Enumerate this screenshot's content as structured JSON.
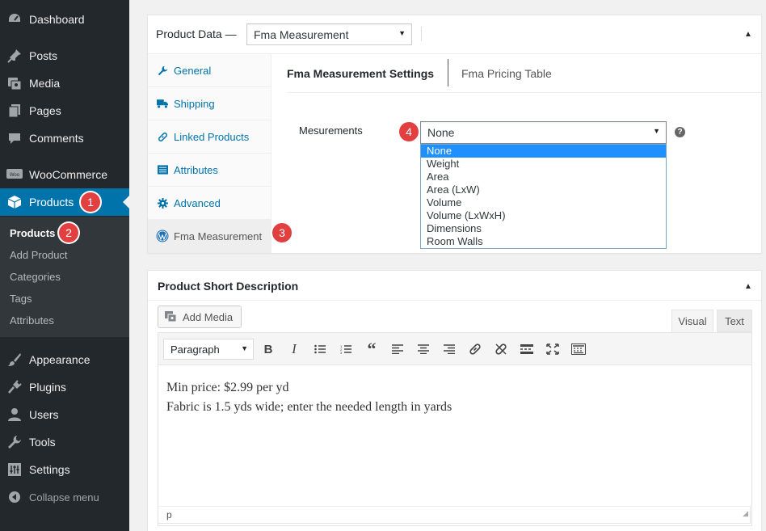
{
  "sidebar": {
    "menu": [
      {
        "label": "Dashboard",
        "icon": "dashboard-icon"
      },
      {
        "label": "Posts",
        "icon": "pushpin-icon"
      },
      {
        "label": "Media",
        "icon": "media-icon"
      },
      {
        "label": "Pages",
        "icon": "pages-icon"
      },
      {
        "label": "Comments",
        "icon": "comments-icon"
      },
      {
        "label": "WooCommerce",
        "icon": "woocommerce-icon"
      },
      {
        "label": "Products",
        "icon": "box-icon",
        "badge": "1"
      },
      {
        "label": "Appearance",
        "icon": "paintbrush-icon"
      },
      {
        "label": "Plugins",
        "icon": "plug-icon"
      },
      {
        "label": "Users",
        "icon": "user-icon"
      },
      {
        "label": "Tools",
        "icon": "wrench-icon"
      },
      {
        "label": "Settings",
        "icon": "settings-icon"
      },
      {
        "label": "Collapse menu",
        "icon": "collapse-icon"
      }
    ],
    "submenu": [
      {
        "label": "Products",
        "badge": "2"
      },
      {
        "label": "Add Product"
      },
      {
        "label": "Categories"
      },
      {
        "label": "Tags"
      },
      {
        "label": "Attributes"
      }
    ]
  },
  "product_data": {
    "title": "Product Data —",
    "type_select": "Fma Measurement",
    "tabs": [
      {
        "label": "General",
        "icon": "wrench-icon"
      },
      {
        "label": "Shipping",
        "icon": "truck-icon"
      },
      {
        "label": "Linked Products",
        "icon": "link-icon"
      },
      {
        "label": "Attributes",
        "icon": "list-icon"
      },
      {
        "label": "Advanced",
        "icon": "gear-icon"
      },
      {
        "label": "Fma Measurement",
        "icon": "wordpress-icon",
        "badge": "3"
      }
    ],
    "subtabs": [
      "Fma Measurement Settings",
      "Fma Pricing Table"
    ],
    "field_label": "Mesurements",
    "field_value": "None",
    "field_badge": "4",
    "options": [
      "None",
      "Weight",
      "Area",
      "Area (LxW)",
      "Volume",
      "Volume (LxWxH)",
      "Dimensions",
      "Room Walls"
    ],
    "selected_option": "None"
  },
  "short_description": {
    "title": "Product Short Description",
    "add_media": "Add Media",
    "tab_visual": "Visual",
    "tab_text": "Text",
    "format": "Paragraph",
    "toolbar": [
      "bold-icon",
      "italic-icon",
      "bullet-list-icon",
      "numbered-list-icon",
      "blockquote-icon",
      "align-left-icon",
      "align-center-icon",
      "align-right-icon",
      "link-icon",
      "unlink-icon",
      "read-more-icon",
      "fullscreen-icon",
      "toolbar-toggle-icon"
    ],
    "content": [
      "Min price: $2.99 per yd",
      "Fabric is 1.5 yds wide; enter the needed length in yards"
    ],
    "path": "p"
  },
  "colors": {
    "sidebar_bg": "#23282d",
    "submenu_bg": "#32373c",
    "active_blue": "#0073aa",
    "badge_red": "#e24040",
    "option_selected": "#1e90ff"
  }
}
